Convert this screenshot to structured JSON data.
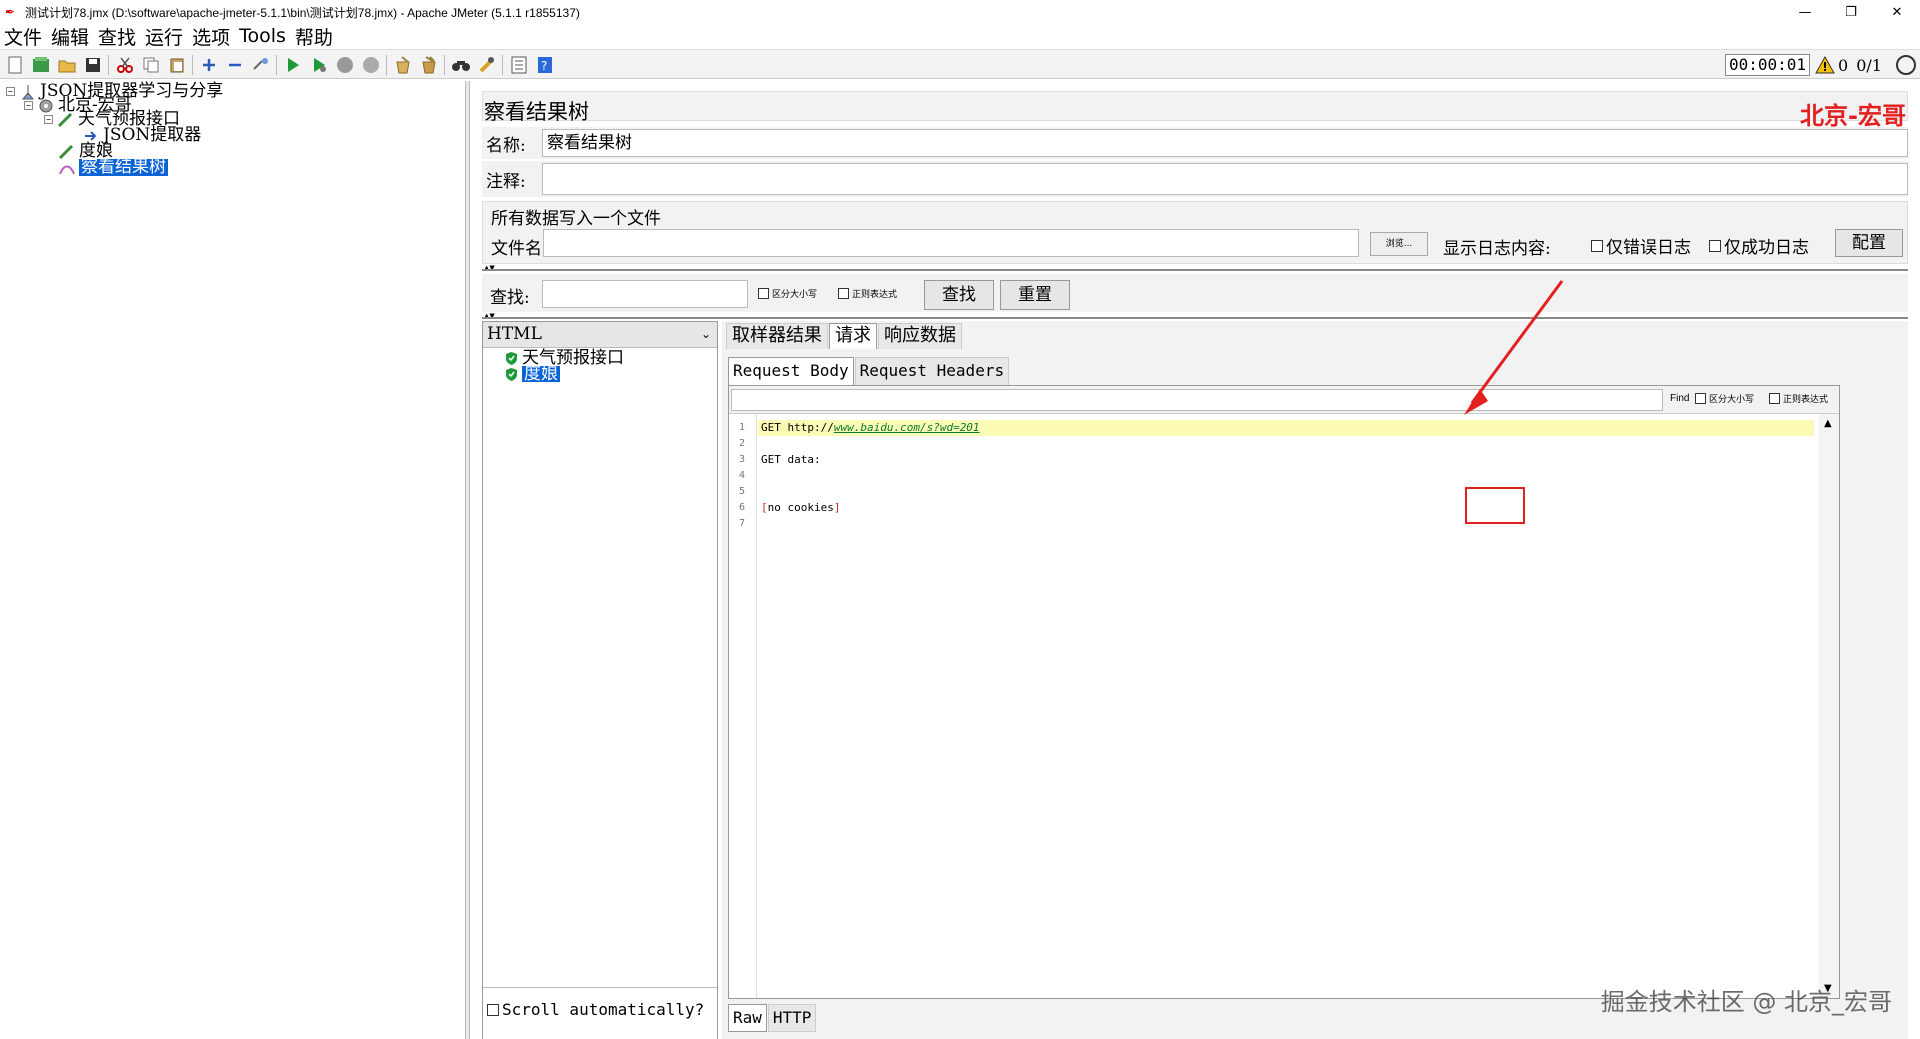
{
  "window": {
    "title": "测试计划78.jmx (D:\\software\\apache-jmeter-5.1.1\\bin\\测试计划78.jmx) - Apache JMeter (5.1.1 r1855137)",
    "controls": [
      "—",
      "❐",
      "✕"
    ]
  },
  "menu": [
    "文件",
    "编辑",
    "查找",
    "运行",
    "选项",
    "Tools",
    "帮助"
  ],
  "toolbar": {
    "timer": "00:00:01",
    "warnings": "0",
    "threads": "0/1"
  },
  "tree": {
    "items": [
      {
        "label": "JSON提取器学习与分享",
        "icon": "test-plan-icon"
      },
      {
        "label": "北京-宏哥",
        "icon": "thread-group-icon"
      },
      {
        "label": "天气预报接口",
        "icon": "sampler-icon"
      },
      {
        "label": "JSON提取器",
        "icon": "extractor-icon"
      },
      {
        "label": "度娘",
        "icon": "sampler-icon"
      },
      {
        "label": "察看结果树",
        "icon": "listener-icon"
      }
    ]
  },
  "panel": {
    "title": "察看结果树",
    "brand": "北京-宏哥",
    "name_label": "名称:",
    "name_value": "察看结果树",
    "comment_label": "注释:",
    "file_group_title": "所有数据写入一个文件",
    "file_label": "文件名",
    "browse_label": "浏览...",
    "log_label": "显示日志内容:",
    "errors_only": "仅错误日志",
    "success_only": "仅成功日志",
    "config_label": "配置"
  },
  "search": {
    "label": "查找:",
    "case_label": "区分大小写",
    "regex_label": "正则表达式",
    "find_button": "查找",
    "reset_button": "重置"
  },
  "results": {
    "renderer": "HTML",
    "items": [
      {
        "label": "天气预报接口",
        "status": "success"
      },
      {
        "label": "度娘",
        "status": "success"
      }
    ],
    "scroll_label": "Scroll automatically?"
  },
  "detail": {
    "tabs": [
      "取样器结果",
      "请求",
      "响应数据"
    ],
    "active_tab": "请求",
    "subtabs": [
      "Request Body",
      "Request Headers"
    ],
    "find_label": "Find",
    "find_case": "区分大小写",
    "find_regex": "正则表达式",
    "lines": [
      "1",
      "2",
      "3",
      "4",
      "5",
      "6",
      "7"
    ],
    "code": {
      "line1_prefix": "GET http://",
      "line1_url": "www.baidu.com/s?wd=201",
      "line3": "GET data:",
      "line6_open": "[",
      "line6_text": "no cookies",
      "line6_close": "]"
    },
    "bottom_tabs": [
      "Raw",
      "HTTP"
    ]
  },
  "watermark": "掘金技术社区 @ 北京_宏哥",
  "colors": {
    "accent_red": "#e32020",
    "selection_blue": "#0a64d6",
    "highlight_yellow": "#fbfbb5"
  }
}
